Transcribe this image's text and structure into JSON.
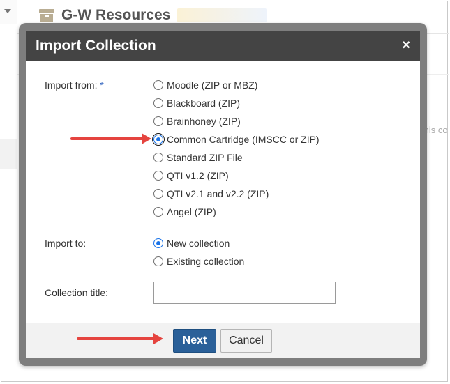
{
  "background": {
    "title": "G-W Resources",
    "partial_text": "this co"
  },
  "modal": {
    "title": "Import Collection",
    "close_label": "×",
    "import_from": {
      "label": "Import from:",
      "required_mark": "*",
      "options": [
        {
          "label": "Moodle (ZIP or MBZ)",
          "checked": false
        },
        {
          "label": "Blackboard (ZIP)",
          "checked": false
        },
        {
          "label": "Brainhoney (ZIP)",
          "checked": false
        },
        {
          "label": "Common Cartridge (IMSCC or ZIP)",
          "checked": true
        },
        {
          "label": "Standard ZIP File",
          "checked": false
        },
        {
          "label": "QTI v1.2 (ZIP)",
          "checked": false
        },
        {
          "label": "QTI v2.1 and v2.2 (ZIP)",
          "checked": false
        },
        {
          "label": "Angel (ZIP)",
          "checked": false
        }
      ]
    },
    "import_to": {
      "label": "Import to:",
      "options": [
        {
          "label": "New collection",
          "checked": true
        },
        {
          "label": "Existing collection",
          "checked": false
        }
      ]
    },
    "collection_title": {
      "label": "Collection title:",
      "value": "",
      "placeholder": ""
    },
    "footer": {
      "next_label": "Next",
      "cancel_label": "Cancel"
    }
  },
  "colors": {
    "header_bg": "#444444",
    "next_button_bg": "#2a6099",
    "arrow": "#e5443f",
    "radio_checked": "#1a73e8"
  }
}
